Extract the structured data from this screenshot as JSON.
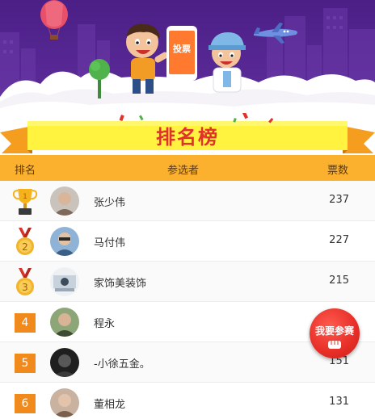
{
  "banner": {
    "phone_label": "投票",
    "title": "排名榜"
  },
  "table": {
    "headers": {
      "rank": "排名",
      "name": "参选者",
      "votes": "票数"
    },
    "rows": [
      {
        "rank": "1",
        "rank_style": "gold-trophy",
        "name": "张少伟",
        "votes": "237",
        "avatar_color": "#9b8f86"
      },
      {
        "rank": "2",
        "rank_style": "silver-medal",
        "name": "马付伟",
        "votes": "227",
        "avatar_color": "#5c7fa3"
      },
      {
        "rank": "3",
        "rank_style": "bronze-medal",
        "name": "家饰美装饰",
        "votes": "215",
        "avatar_color": "#d8dde3"
      },
      {
        "rank": "4",
        "rank_style": "number-box",
        "name": "程永",
        "votes": "",
        "avatar_color": "#6e8a5a"
      },
      {
        "rank": "5",
        "rank_style": "number-box",
        "name": "-小徐五金。",
        "votes": "151",
        "avatar_color": "#2a2a2a"
      },
      {
        "rank": "6",
        "rank_style": "number-box",
        "name": "董相龙",
        "votes": "131",
        "avatar_color": "#b69a86"
      }
    ]
  },
  "join_button": {
    "label": "我要参赛",
    "icon": "fist-icon"
  },
  "colors": {
    "header_bg": "#fbb12e",
    "rank_box": "#f18a1c",
    "title_red": "#e0322b",
    "banner_purple": "#4b1f86",
    "join_red": "#e62e27"
  }
}
